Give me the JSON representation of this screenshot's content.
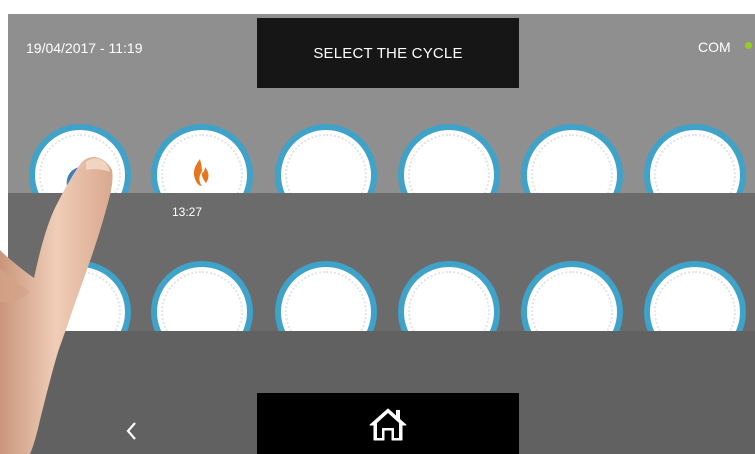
{
  "header": {
    "datetime": "19/04/2017 - 11:19",
    "title": "SELECT THE CYCLE",
    "com_label": "COM",
    "com_status_color": "#8fd11d"
  },
  "cycles_row_1": [
    {
      "icon": "partial-blue-arc-icon",
      "timer": ""
    },
    {
      "icon": "flame-icon",
      "timer": "13:27"
    },
    {
      "icon": "",
      "timer": ""
    },
    {
      "icon": "",
      "timer": ""
    },
    {
      "icon": "",
      "timer": ""
    },
    {
      "icon": "",
      "timer": ""
    }
  ],
  "cycles_row_2": [
    {
      "icon": "",
      "timer": ""
    },
    {
      "icon": "",
      "timer": ""
    },
    {
      "icon": "",
      "timer": ""
    },
    {
      "icon": "",
      "timer": ""
    },
    {
      "icon": "",
      "timer": ""
    },
    {
      "icon": "",
      "timer": ""
    }
  ],
  "footer": {
    "back_icon": "chevron-left-icon",
    "home_icon": "home-icon"
  },
  "colors": {
    "dial_ring": "#3ea2c9",
    "flame": "#e8741c",
    "top_panel": "#8f8f8f",
    "middle_panel": "#6b6b6b",
    "bottom_panel": "#616161"
  }
}
